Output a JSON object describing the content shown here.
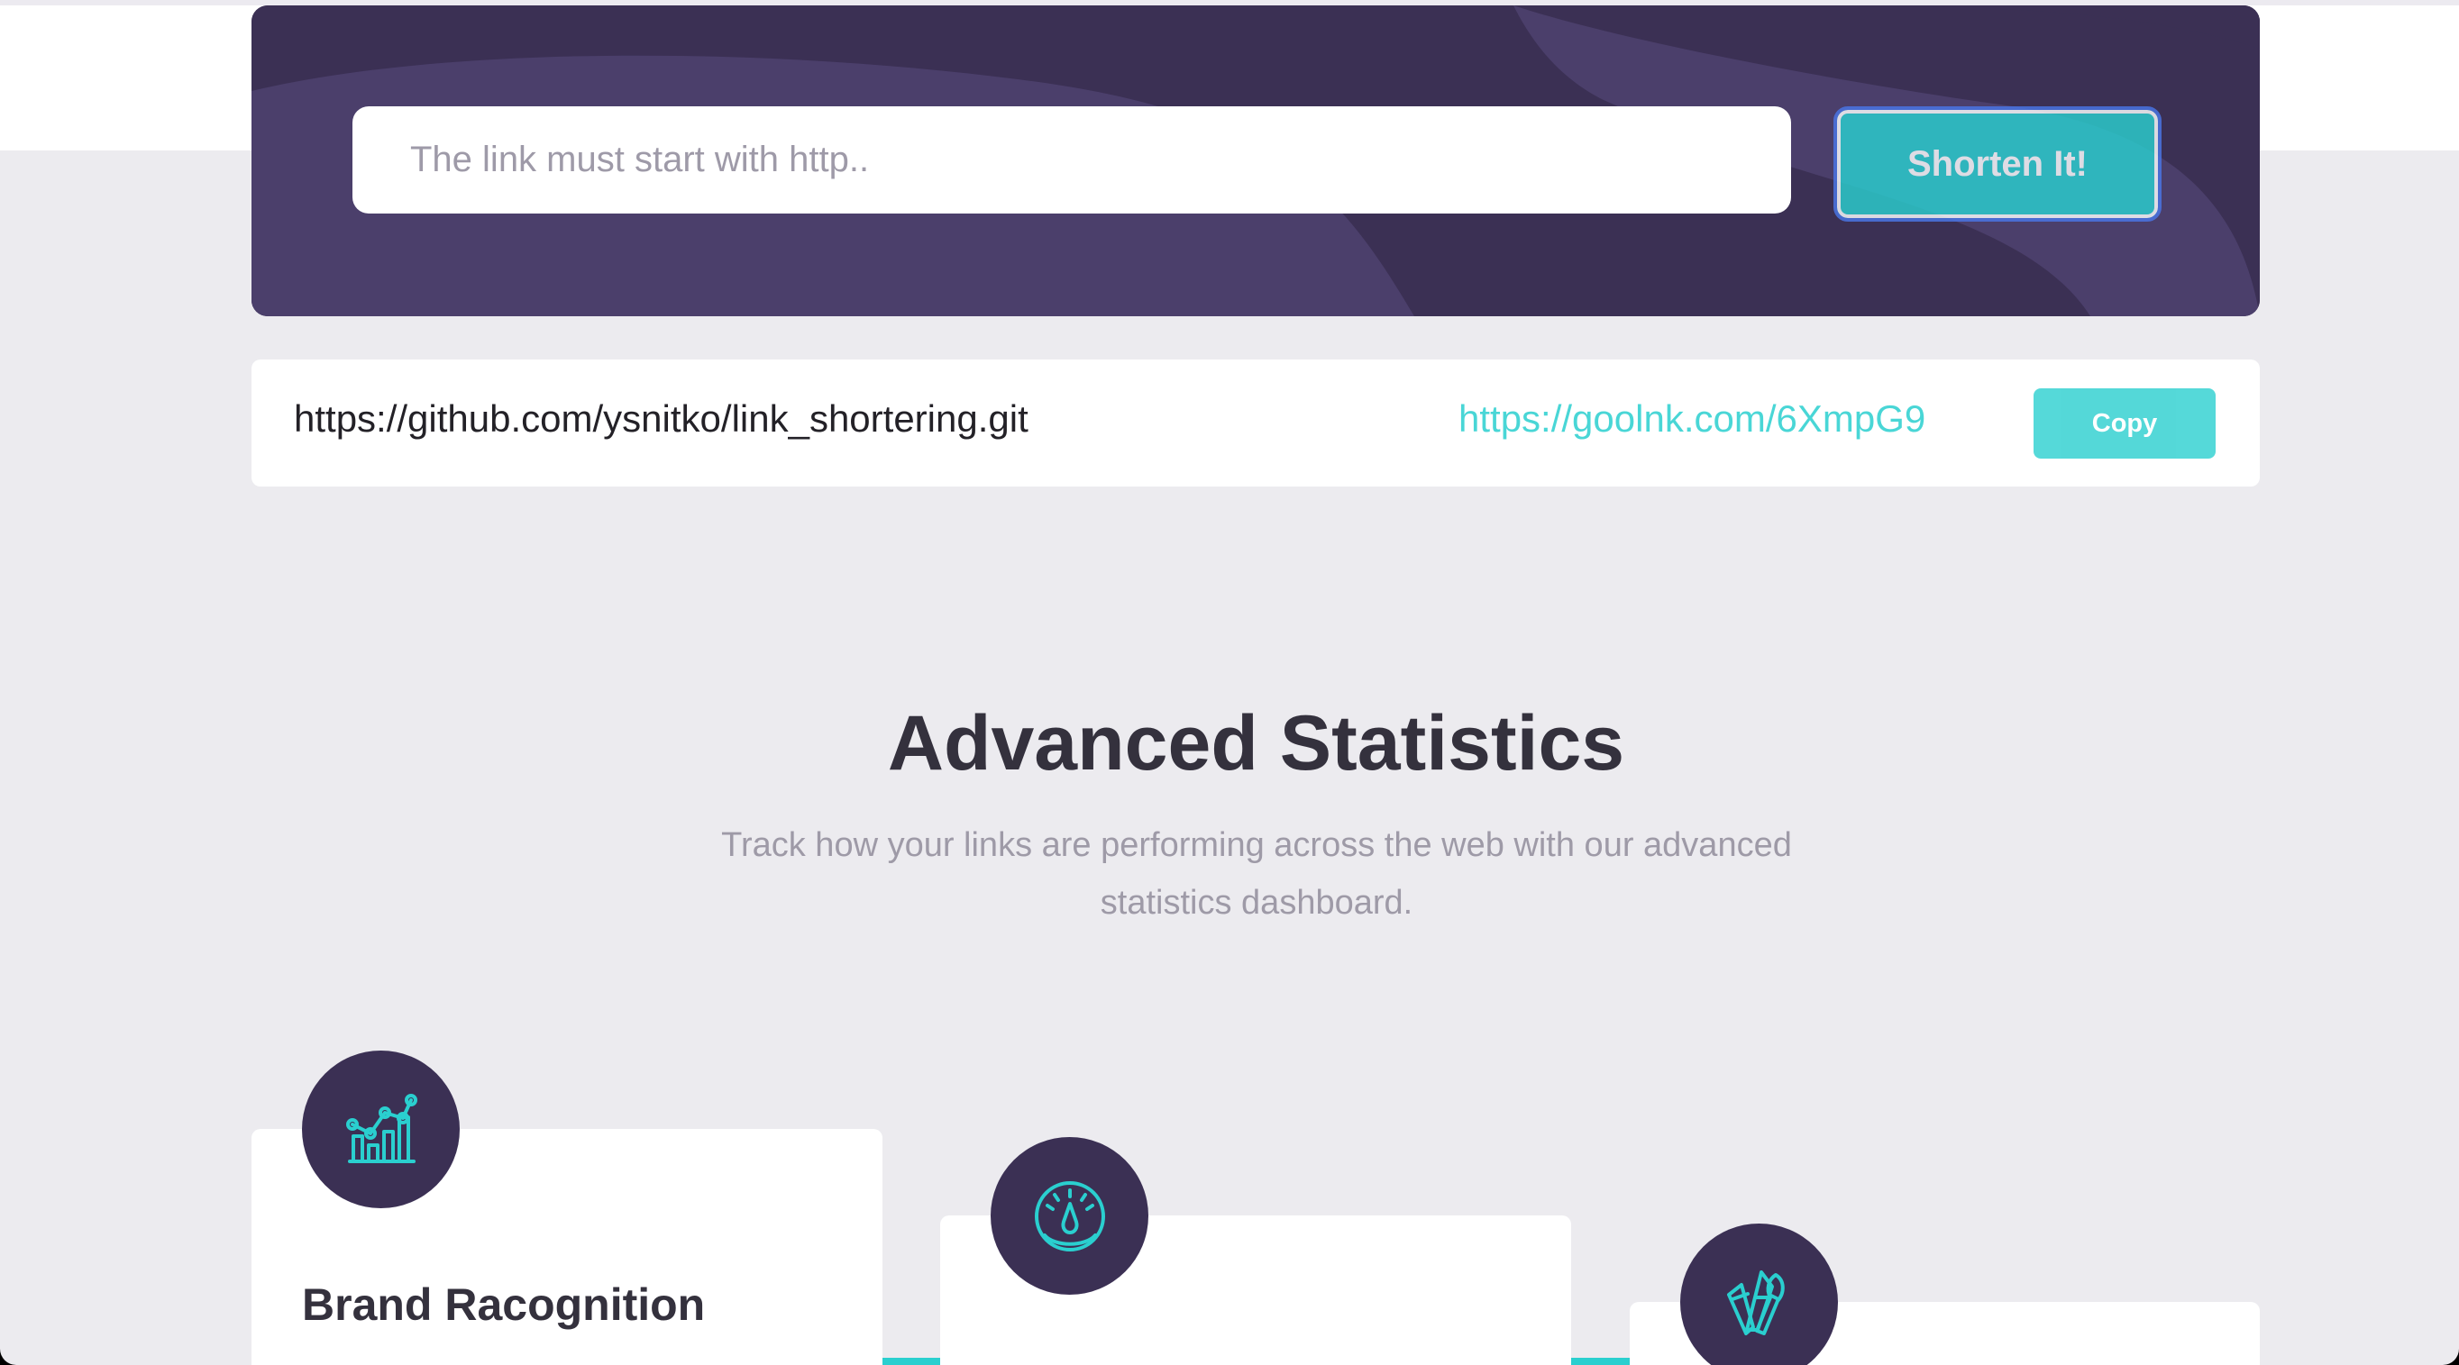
{
  "form": {
    "placeholder": "The link must start with http..",
    "button_label": "Shorten It!"
  },
  "result": {
    "original_url": "https://github.com/ysnitko/link_shortering.git",
    "short_url": "https://goolnk.com/6XmpG9",
    "copy_label": "Copy"
  },
  "statistics": {
    "title": "Advanced Statistics",
    "description": "Track how your links are performing across the web with our advanced statistics dashboard."
  },
  "features": [
    {
      "title": "Brand Racognition",
      "icon": "brand-recognition-chart-icon"
    },
    {
      "icon": "speedometer-icon"
    },
    {
      "icon": "pen-brush-icon"
    }
  ],
  "colors": {
    "page_background": "#ecebef",
    "dark_violet": "#3b3054",
    "cyan": "#2acfcf",
    "text_dark": "#34313d",
    "text_muted": "#9e9aa7",
    "focus_blue": "#4a77e8"
  }
}
